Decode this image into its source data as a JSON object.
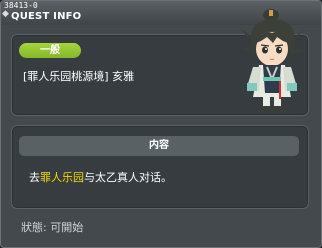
{
  "window": {
    "quest_id": "38413-0",
    "title": "QUEST INFO"
  },
  "quest": {
    "category": "一般",
    "name": "[罪人乐园桃源境] 亥雅"
  },
  "content": {
    "header": "内容",
    "description_prefix": "去",
    "description_highlight": "罪人乐园",
    "description_suffix": "与太乙真人对话。"
  },
  "status": {
    "label": "狀態:",
    "value": "可開始"
  },
  "npc": {
    "icon": "npc-portrait-icon"
  },
  "colors": {
    "badge": "#95c634",
    "highlight": "#f0d800"
  }
}
